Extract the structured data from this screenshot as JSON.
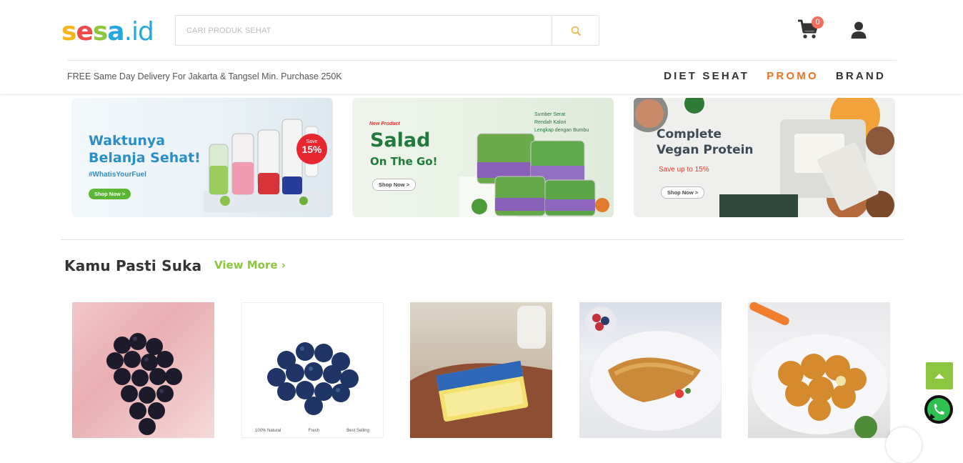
{
  "header": {
    "logo_parts": [
      "s",
      "e",
      "s",
      "a",
      ".id"
    ],
    "search": {
      "placeholder": "CARI PRODUK SEHAT"
    },
    "cart_count": "0",
    "tagline": "FREE Same Day Delivery For Jakarta & Tangsel Min. Purchase 250K",
    "nav": [
      "DIET SEHAT",
      "PROMO",
      "BRAND"
    ]
  },
  "banners": [
    {
      "title_line1": "Waktunya",
      "title_line2": "Belanja Sehat!",
      "hashtag": "#WhatisYourFuel",
      "button": "Shop Now >",
      "badge_top": "Save",
      "badge_value": "15%"
    },
    {
      "tag": "New Product",
      "title_line1": "Salad",
      "title_line2": "On The Go!",
      "button": "Shop Now >",
      "bullets": [
        "Sumber Serat",
        "Rendah Kalori",
        "Lengkap dengan Bumbu"
      ]
    },
    {
      "title_line1": "Complete",
      "title_line2": "Vegan Protein",
      "save": "Save up to 15%",
      "button": "Shop Now >"
    }
  ],
  "section": {
    "title": "Kamu Pasti Suka",
    "view_more": "View More ›"
  },
  "product_badges": [
    "100% Natural",
    "Fresh",
    "Best Selling"
  ],
  "colors": {
    "accent_green": "#8cc63f",
    "promo_orange": "#f07321",
    "badge_red": "#f26b5b"
  },
  "icons": [
    "search-icon",
    "cart-icon",
    "user-icon",
    "chevron-up-icon",
    "whatsapp-icon"
  ]
}
